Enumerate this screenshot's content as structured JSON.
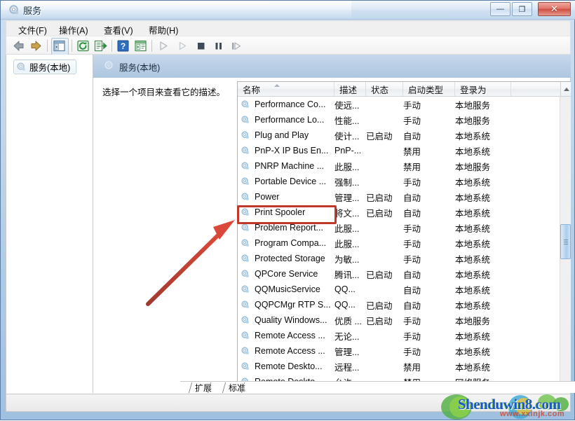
{
  "window": {
    "title": "服务",
    "icon": "services-gear-icon",
    "buttons": {
      "minimize": "—",
      "maximize": "❐",
      "close": "✕"
    }
  },
  "menubar": {
    "items": [
      {
        "label": "文件(F)",
        "name": "menu-file"
      },
      {
        "label": "操作(A)",
        "name": "menu-action"
      },
      {
        "label": "查看(V)",
        "name": "menu-view"
      },
      {
        "label": "帮助(H)",
        "name": "menu-help"
      }
    ]
  },
  "toolbar": {
    "items": [
      {
        "name": "back-button",
        "icon": "arrow-left-icon"
      },
      {
        "name": "forward-button",
        "icon": "arrow-right-icon"
      },
      {
        "name": "show-hide-tree-button",
        "icon": "tree-pane-icon"
      },
      {
        "name": "refresh-button",
        "icon": "refresh-icon"
      },
      {
        "name": "export-list-button",
        "icon": "export-icon"
      },
      {
        "name": "help-button",
        "icon": "question-mark-icon"
      },
      {
        "name": "properties-button",
        "icon": "properties-icon"
      },
      {
        "name": "start-service-button",
        "icon": "play-icon"
      },
      {
        "name": "restart-service-button",
        "icon": "replay-icon"
      },
      {
        "name": "stop-service-button",
        "icon": "stop-icon"
      },
      {
        "name": "pause-service-button",
        "icon": "pause-icon"
      },
      {
        "name": "resume-service-button",
        "icon": "step-forward-icon"
      }
    ]
  },
  "tree": {
    "root_label": "服务(本地)",
    "root_icon": "services-gear-icon"
  },
  "pane": {
    "header_title": "服务(本地)",
    "header_icon": "services-gear-icon",
    "description_placeholder": "选择一个项目来查看它的描述。"
  },
  "list": {
    "columns": [
      {
        "label": "名称",
        "name": "column-name",
        "sorted": true
      },
      {
        "label": "描述",
        "name": "column-description"
      },
      {
        "label": "状态",
        "name": "column-status"
      },
      {
        "label": "启动类型",
        "name": "column-startup-type"
      },
      {
        "label": "登录为",
        "name": "column-log-on-as"
      }
    ],
    "rows": [
      {
        "name": "Performance Co...",
        "description": "使远...",
        "status": "",
        "startup": "手动",
        "logon": "本地服务"
      },
      {
        "name": "Performance Lo...",
        "description": "性能...",
        "status": "",
        "startup": "手动",
        "logon": "本地服务"
      },
      {
        "name": "Plug and Play",
        "description": "使计...",
        "status": "已启动",
        "startup": "自动",
        "logon": "本地系统"
      },
      {
        "name": "PnP-X IP Bus En...",
        "description": "PnP-...",
        "status": "",
        "startup": "禁用",
        "logon": "本地系统"
      },
      {
        "name": "PNRP Machine ...",
        "description": "此服...",
        "status": "",
        "startup": "禁用",
        "logon": "本地服务"
      },
      {
        "name": "Portable Device ...",
        "description": "强制...",
        "status": "",
        "startup": "手动",
        "logon": "本地系统"
      },
      {
        "name": "Power",
        "description": "管理...",
        "status": "已启动",
        "startup": "自动",
        "logon": "本地系统"
      },
      {
        "name": "Print Spooler",
        "description": "将文...",
        "status": "已启动",
        "startup": "自动",
        "logon": "本地系统",
        "highlighted": true
      },
      {
        "name": "Problem Report...",
        "description": "此服...",
        "status": "",
        "startup": "手动",
        "logon": "本地系统"
      },
      {
        "name": "Program Compa...",
        "description": "此服...",
        "status": "",
        "startup": "手动",
        "logon": "本地系统"
      },
      {
        "name": "Protected Storage",
        "description": "为敏...",
        "status": "",
        "startup": "手动",
        "logon": "本地系统"
      },
      {
        "name": "QPCore Service",
        "description": "腾讯...",
        "status": "已启动",
        "startup": "自动",
        "logon": "本地系统"
      },
      {
        "name": "QQMusicService",
        "description": "QQ...",
        "status": "",
        "startup": "自动",
        "logon": "本地系统"
      },
      {
        "name": "QQPCMgr RTP S...",
        "description": "QQ...",
        "status": "已启动",
        "startup": "自动",
        "logon": "本地系统"
      },
      {
        "name": "Quality Windows...",
        "description": "优质 ...",
        "status": "已启动",
        "startup": "手动",
        "logon": "本地服务"
      },
      {
        "name": "Remote Access ...",
        "description": "无论...",
        "status": "",
        "startup": "手动",
        "logon": "本地系统"
      },
      {
        "name": "Remote Access ...",
        "description": "管理...",
        "status": "",
        "startup": "手动",
        "logon": "本地系统"
      },
      {
        "name": "Remote Deskto...",
        "description": "远程...",
        "status": "",
        "startup": "禁用",
        "logon": "本地系统"
      },
      {
        "name": "Remote Deskto...",
        "description": "允许...",
        "status": "",
        "startup": "禁用",
        "logon": "网络服务"
      }
    ]
  },
  "tabs": [
    {
      "label": "扩展",
      "name": "tab-extended"
    },
    {
      "label": "标准",
      "name": "tab-standard"
    }
  ],
  "annotations": {
    "highlight_color": "#c0392b",
    "arrow_color": "#d9483b",
    "highlight_target": "Print Spooler"
  },
  "watermark": {
    "text": "Shenduwin8.com",
    "subtext": "www.xxinjk.com"
  }
}
